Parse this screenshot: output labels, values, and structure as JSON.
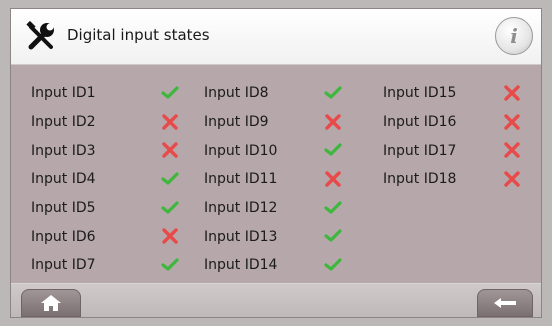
{
  "header": {
    "title": "Digital input states",
    "tool_icon": "tools-icon",
    "info_icon": "info-icon",
    "info_glyph": "i"
  },
  "colors": {
    "on": "#3db83d",
    "off": "#e84a4a",
    "panel": "#b6a7aa"
  },
  "inputs": [
    {
      "label": "Input ID1",
      "state": "on"
    },
    {
      "label": "Input ID2",
      "state": "off"
    },
    {
      "label": "Input ID3",
      "state": "off"
    },
    {
      "label": "Input ID4",
      "state": "on"
    },
    {
      "label": "Input ID5",
      "state": "on"
    },
    {
      "label": "Input ID6",
      "state": "off"
    },
    {
      "label": "Input ID7",
      "state": "on"
    },
    {
      "label": "Input ID8",
      "state": "on"
    },
    {
      "label": "Input ID9",
      "state": "off"
    },
    {
      "label": "Input ID10",
      "state": "on"
    },
    {
      "label": "Input ID11",
      "state": "off"
    },
    {
      "label": "Input ID12",
      "state": "on"
    },
    {
      "label": "Input ID13",
      "state": "on"
    },
    {
      "label": "Input ID14",
      "state": "on"
    },
    {
      "label": "Input ID15",
      "state": "off"
    },
    {
      "label": "Input ID16",
      "state": "off"
    },
    {
      "label": "Input ID17",
      "state": "off"
    },
    {
      "label": "Input ID18",
      "state": "off"
    }
  ],
  "footer": {
    "home_icon": "home-icon",
    "back_icon": "back-arrow-icon"
  }
}
